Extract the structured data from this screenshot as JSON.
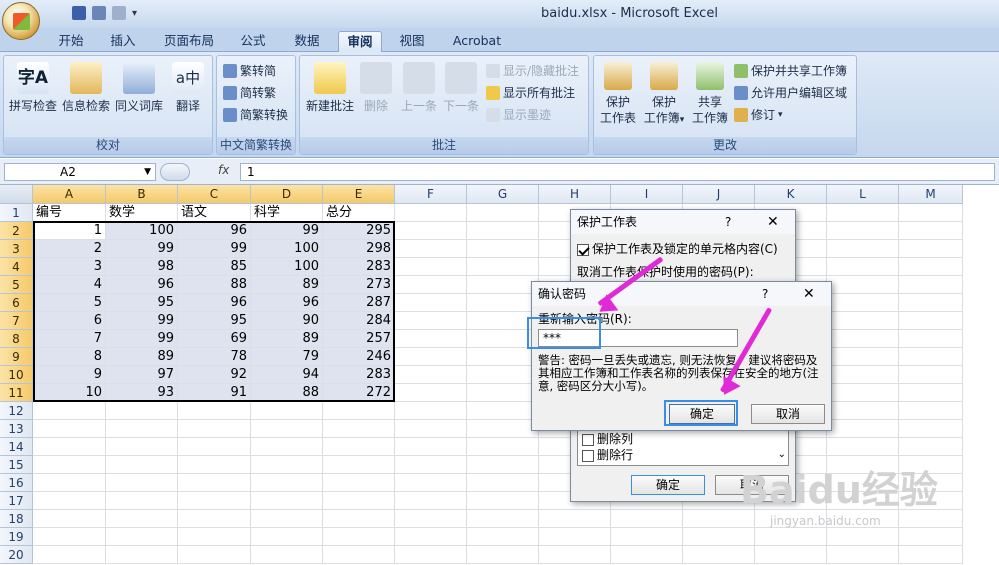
{
  "app": {
    "title": "baidu.xlsx - Microsoft Excel"
  },
  "tabs": [
    "开始",
    "插入",
    "页面布局",
    "公式",
    "数据",
    "审阅",
    "视图",
    "Acrobat"
  ],
  "ribbon": {
    "proofing": {
      "label": "校对",
      "buttons": [
        "拼写检查",
        "信息检索",
        "同义词库",
        "翻译"
      ]
    },
    "chinese": {
      "label": "中文简繁转换",
      "buttons": [
        "繁转简",
        "简转繁",
        "简繁转换"
      ]
    },
    "comments": {
      "label": "批注",
      "new": "新建批注",
      "delete": "删除",
      "prev": "上一条",
      "next": "下一条",
      "show_hide": "显示/隐藏批注",
      "show_all": "显示所有批注",
      "show_ink": "显示墨迹"
    },
    "changes": {
      "label": "更改",
      "protect_sheet": [
        "保护",
        "工作表"
      ],
      "protect_book": [
        "保护",
        "工作簿"
      ],
      "share_book": [
        "共享",
        "工作簿"
      ],
      "protect_share": "保护并共享工作簿",
      "allow_edit": "允许用户编辑区域",
      "track": "修订"
    }
  },
  "formula": {
    "namebox": "A2",
    "fx": "fx",
    "value": "1"
  },
  "columns": [
    "A",
    "B",
    "C",
    "D",
    "E",
    "F",
    "G",
    "H",
    "I",
    "J",
    "K",
    "L",
    "M"
  ],
  "rows": [
    "1",
    "2",
    "3",
    "4",
    "5",
    "6",
    "7",
    "8",
    "9",
    "10",
    "11",
    "12",
    "13",
    "14",
    "15",
    "16",
    "17",
    "18",
    "19",
    "20"
  ],
  "table": {
    "headers": [
      "编号",
      "数学",
      "语文",
      "科学",
      "总分"
    ],
    "data": [
      [
        "1",
        "100",
        "96",
        "99",
        "295"
      ],
      [
        "2",
        "99",
        "99",
        "100",
        "298"
      ],
      [
        "3",
        "98",
        "85",
        "100",
        "283"
      ],
      [
        "4",
        "96",
        "88",
        "89",
        "273"
      ],
      [
        "5",
        "95",
        "96",
        "96",
        "287"
      ],
      [
        "6",
        "99",
        "95",
        "90",
        "284"
      ],
      [
        "7",
        "99",
        "69",
        "89",
        "257"
      ],
      [
        "8",
        "89",
        "78",
        "79",
        "246"
      ],
      [
        "9",
        "97",
        "92",
        "94",
        "283"
      ],
      [
        "10",
        "93",
        "91",
        "88",
        "272"
      ]
    ]
  },
  "protect_dialog": {
    "title": "保护工作表",
    "help": "?",
    "check_label": "保护工作表及锁定的单元格内容(C)",
    "password_label": "取消工作表保护时使用的密码(P):",
    "list_items": [
      "删除列",
      "删除行"
    ],
    "ok": "确定",
    "cancel": "取消"
  },
  "confirm_dialog": {
    "title": "确认密码",
    "help": "?",
    "label": "重新输入密码(R):",
    "value": "***",
    "warning": "警告: 密码一旦丢失或遗忘, 则无法恢复。建议将密码及其相应工作簿和工作表名称的列表保存在安全的地方(注意, 密码区分大小写)。",
    "ok": "确定",
    "cancel": "取消"
  },
  "watermark": {
    "logo": "Baidu经验",
    "url": "jingyan.baidu.com"
  },
  "colors": {
    "accent": "#e02ad8",
    "highlight": "#3a8ee6"
  }
}
